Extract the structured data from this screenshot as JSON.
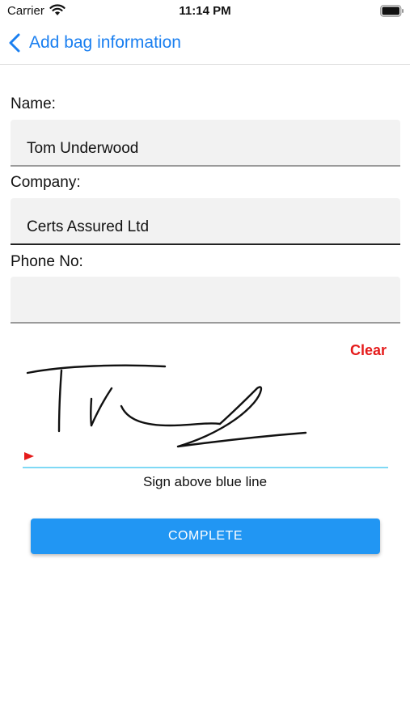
{
  "status_bar": {
    "carrier": "Carrier",
    "time": "11:14 PM",
    "icons": [
      "wifi-icon",
      "battery-icon"
    ]
  },
  "nav": {
    "back_icon": "chevron-left-icon",
    "title": "Add bag information",
    "accent_color": "#1a7ff0"
  },
  "form": {
    "name": {
      "label": "Name:",
      "value": "Tom Underwood"
    },
    "company": {
      "label": "Company:",
      "value": "Certs Assured Ltd"
    },
    "phone": {
      "label": "Phone No:",
      "value": ""
    }
  },
  "signature": {
    "clear_label": "Clear",
    "clear_color": "#e51b1b",
    "hint": "Sign above blue line",
    "line_color": "#7fd9f5"
  },
  "actions": {
    "complete_label": "COMPLETE",
    "complete_color": "#2196f3"
  }
}
